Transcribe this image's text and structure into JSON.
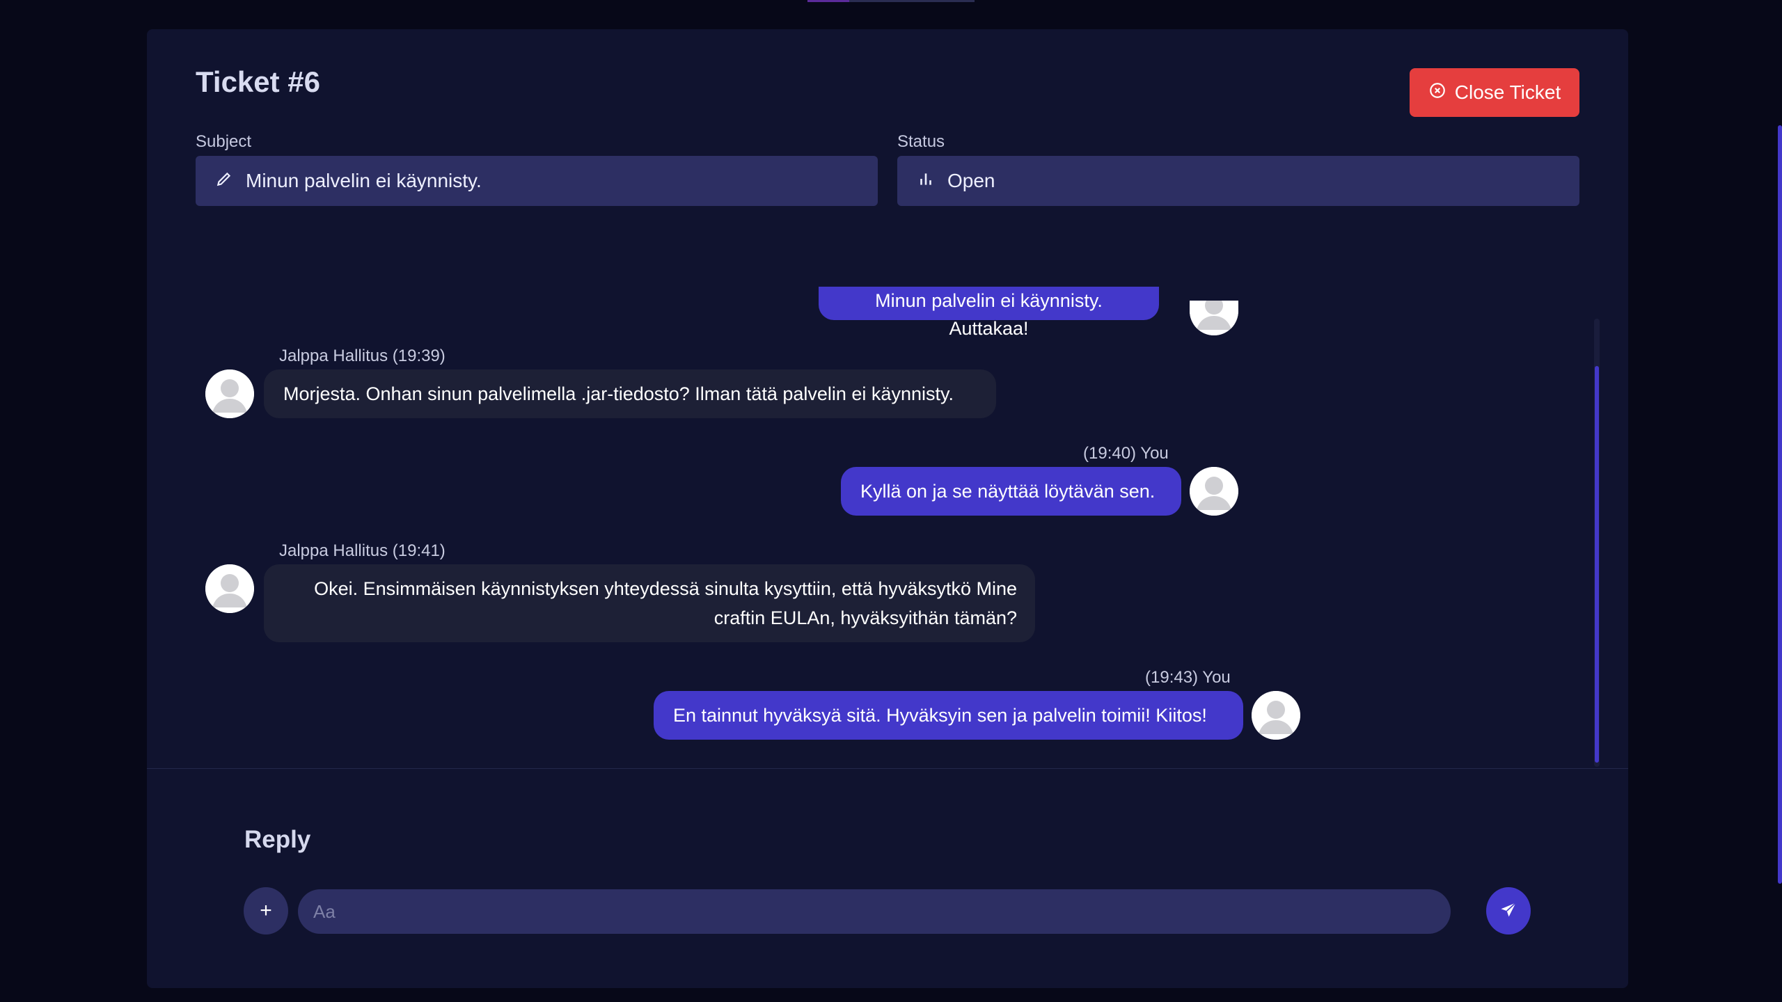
{
  "ticket": {
    "title": "Ticket #6",
    "close_label": "Close Ticket",
    "subject_label": "Subject",
    "subject_value": "Minun palvelin ei käynnisty.",
    "status_label": "Status",
    "status_value": "Open"
  },
  "messages": [
    {
      "side": "mine",
      "meta": "",
      "text": "Minun palvelin ei käynnisty. Auttakaa!"
    },
    {
      "side": "other",
      "meta": "Jalppa Hallitus (19:39)",
      "text": "Morjesta. Onhan sinun palvelimella .jar-tiedosto? Ilman tätä palvelin ei käynnisty."
    },
    {
      "side": "mine",
      "meta": "(19:40) You",
      "text": "Kyllä on ja se näyttää löytävän sen."
    },
    {
      "side": "other",
      "meta": "Jalppa Hallitus (19:41)",
      "text": "Okei. Ensimmäisen käynnistyksen yhteydessä sinulta kysyttiin, että hyväksytkö Mine craftin EULAn, hyväksyithän tämän?"
    },
    {
      "side": "mine",
      "meta": "(19:43) You",
      "text": "En tainnut hyväksyä sitä. Hyväksyin sen ja palvelin toimii! Kiitos!"
    }
  ],
  "reply": {
    "title": "Reply",
    "placeholder": "Aa",
    "plus_label": "+"
  },
  "colors": {
    "accent": "#4338ca",
    "danger": "#e53e3e",
    "panel": "#10132f",
    "field": "#2d2f63"
  }
}
